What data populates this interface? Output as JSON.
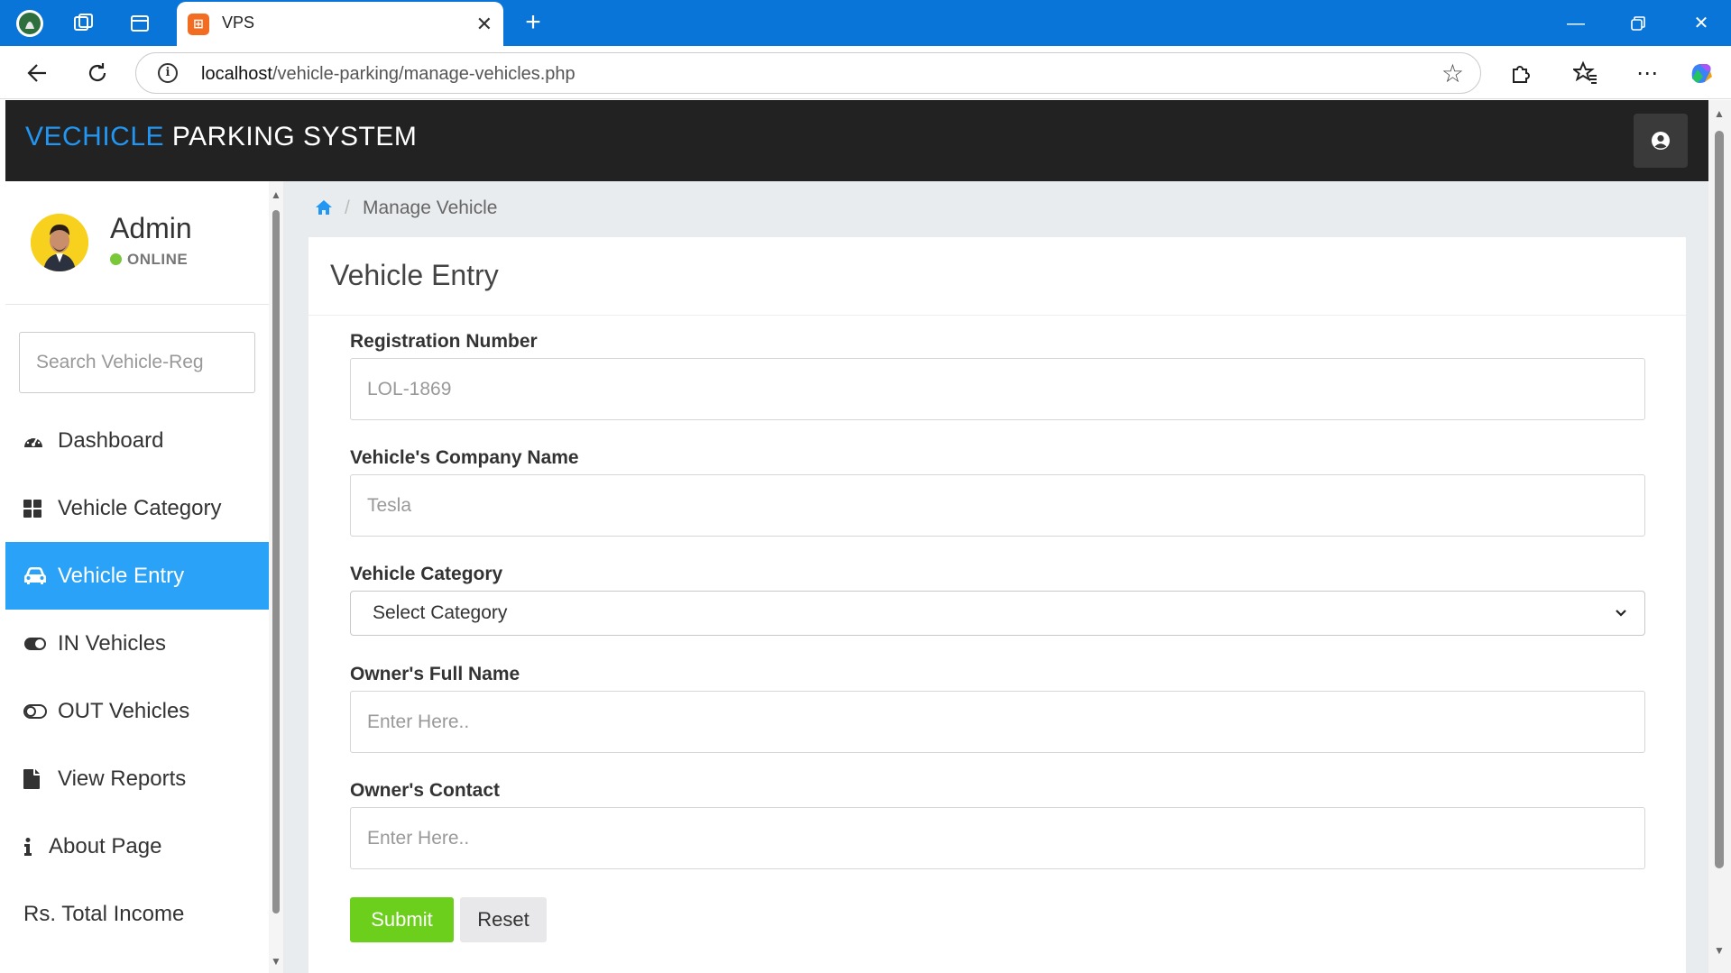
{
  "browser": {
    "tab_title": "VPS",
    "tab_favicon_text": "⊞",
    "url_host": "localhost",
    "url_path": "/vehicle-parking/manage-vehicles.php",
    "accent_color": "#0a75d8"
  },
  "app": {
    "brand_part1": "VECHICLE",
    "brand_part2": "PARKING SYSTEM",
    "brand_color": "#2196f3",
    "topbar_color": "#222222"
  },
  "sidebar": {
    "profile_name": "Admin",
    "profile_status": "ONLINE",
    "search_placeholder": "Search Vehicle-Reg",
    "items": [
      {
        "label": "Dashboard",
        "icon": "dashboard-icon"
      },
      {
        "label": "Vehicle Category",
        "icon": "grid-icon"
      },
      {
        "label": "Vehicle Entry",
        "icon": "car-icon",
        "active": true
      },
      {
        "label": "IN Vehicles",
        "icon": "toggle-on-icon"
      },
      {
        "label": "OUT Vehicles",
        "icon": "toggle-off-icon"
      },
      {
        "label": "View Reports",
        "icon": "file-icon"
      },
      {
        "label": "About Page",
        "icon": "info-icon"
      },
      {
        "label": "Rs. Total Income",
        "icon": ""
      }
    ],
    "active_color": "#2aa2f8"
  },
  "breadcrumb": {
    "current": "Manage Vehicle"
  },
  "card": {
    "title": "Vehicle Entry"
  },
  "form": {
    "reg_label": "Registration Number",
    "reg_placeholder": "LOL-1869",
    "company_label": "Vehicle's Company Name",
    "company_placeholder": "Tesla",
    "category_label": "Vehicle Category",
    "category_selected": "Select Category",
    "owner_label": "Owner's Full Name",
    "owner_placeholder": "Enter Here..",
    "contact_label": "Owner's Contact",
    "contact_placeholder": "Enter Here..",
    "submit_label": "Submit",
    "reset_label": "Reset",
    "submit_color": "#6ccf1c"
  }
}
